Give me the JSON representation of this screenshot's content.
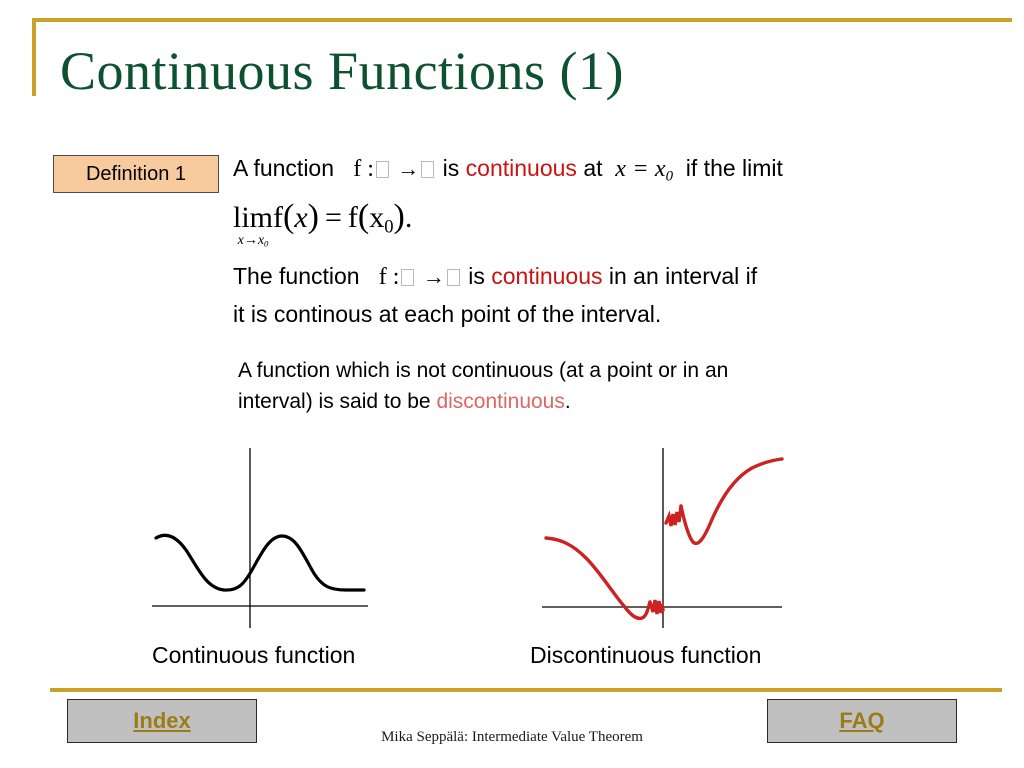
{
  "slide": {
    "title": "Continuous Functions (1)",
    "accent_gold": "#c9a227",
    "title_color": "#0d5130",
    "keyword_red": "#cc1111",
    "keyword_pink": "#e06666",
    "badge_fill": "#f8cb9f",
    "button_fill": "#c0c0c0",
    "button_text_color": "#9a7d19",
    "graph_continuous_color": "#000000",
    "graph_discontinuous_color": "#cc2222"
  },
  "definition": {
    "badge_label": "Definition 1",
    "paragraph1": {
      "t1": "A function",
      "f": "f :",
      "arrow": "→",
      "t2": "is",
      "keyword": "continuous",
      "t3": "at",
      "math_x": "x",
      "math_eq": "=",
      "math_x0": "x",
      "math_x0_sub": "0",
      "t4": "if the limit"
    },
    "formula": {
      "lim": "lim",
      "lim_sub_x": "x",
      "lim_sub_arrow": "→",
      "lim_sub_x0": "x",
      "lim_sub_x0_sub": "0",
      "f1": "f",
      "open1": "(",
      "var": "x",
      "close1": ")",
      "eq": "=",
      "f2": "f",
      "open2": "(",
      "var2": "x",
      "var2_sub": "0",
      "close2": ")",
      "period": "."
    }
  },
  "interval_paragraph": {
    "line1_a": "The function",
    "line1_f": "f :",
    "line1_arrow": "→",
    "line1_b": "is",
    "line1_keyword": "continuous",
    "line1_c": "in an interval if",
    "line2": "it is continous  at each point of the interval."
  },
  "discontinuous_paragraph": {
    "line1": "A function which is not  continuous  (at a point or in an",
    "line2_a": "interval) is said to be",
    "line2_keyword": "discontinuous",
    "line2_b": "."
  },
  "figures": {
    "left_caption": "Continuous function",
    "right_caption": "Discontinuous function"
  },
  "footer": {
    "index_label": "Index",
    "faq_label": "FAQ",
    "note": "Mika Seppälä: Intermediate Value Theorem"
  }
}
